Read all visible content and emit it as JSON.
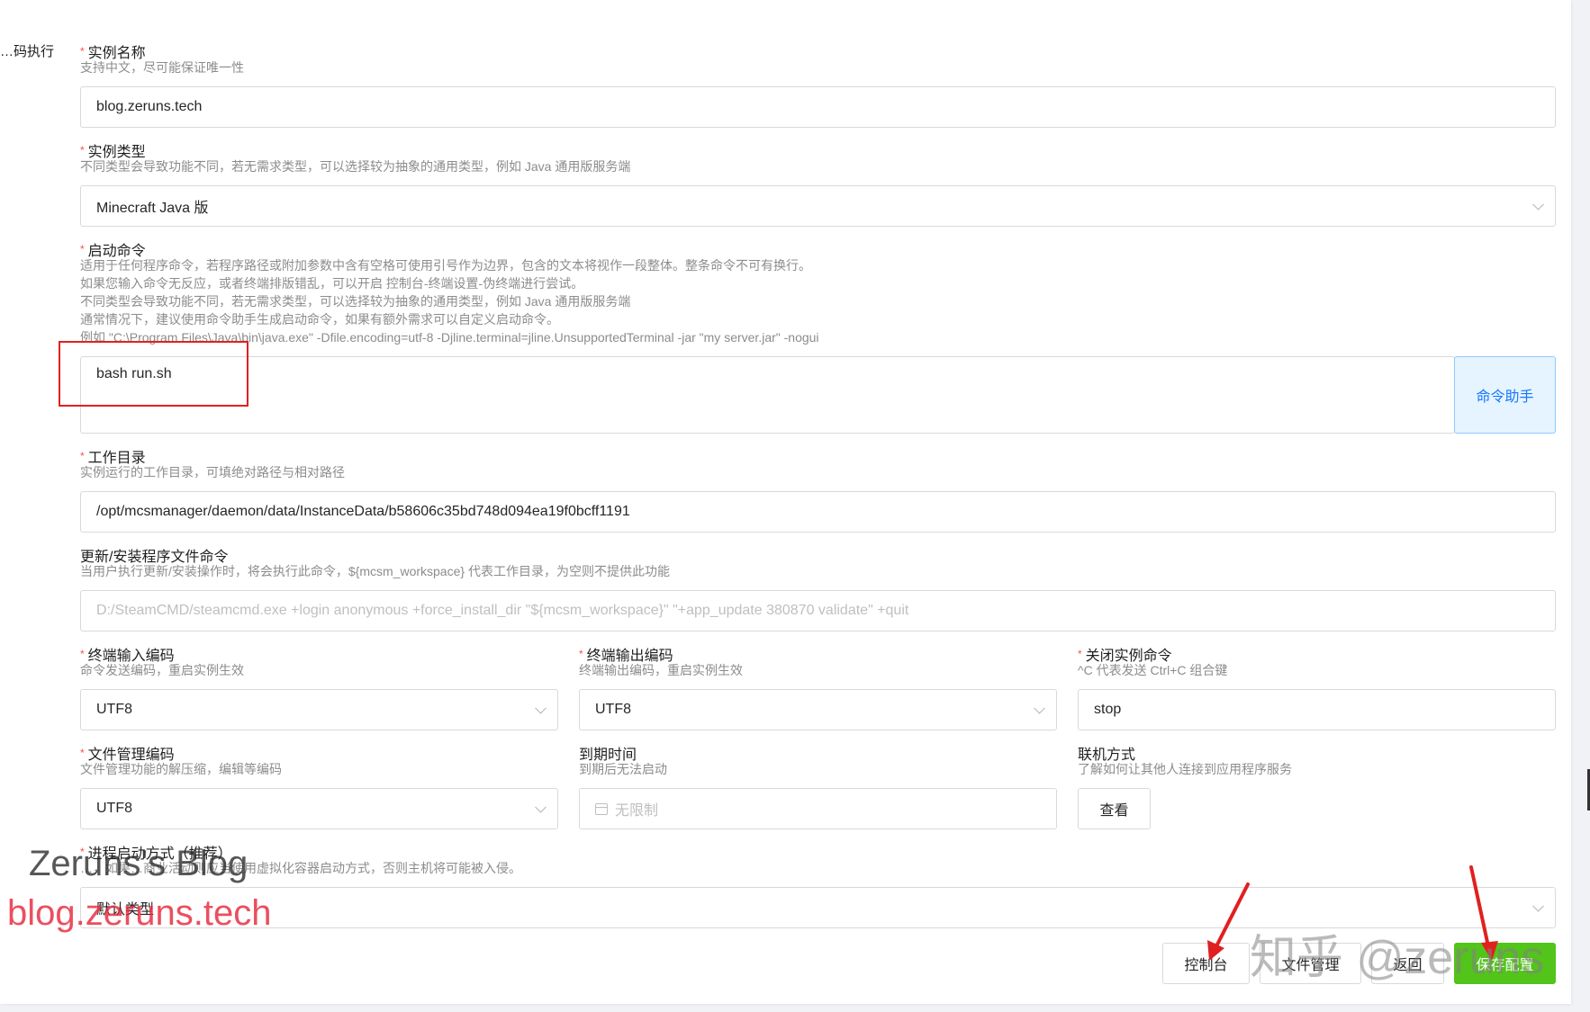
{
  "sidebar": {
    "partial_label": "…码执行"
  },
  "form": {
    "instance_name": {
      "label": "实例名称",
      "help": "支持中文，尽可能保证唯一性",
      "value": "blog.zeruns.tech"
    },
    "instance_type": {
      "label": "实例类型",
      "help": "不同类型会导致功能不同，若无需求类型，可以选择较为抽象的通用类型，例如 Java 通用版服务端",
      "value": "Minecraft Java 版"
    },
    "start_command": {
      "label": "启动命令",
      "help_lines": [
        "适用于任何程序命令，若程序路径或附加参数中含有空格可使用引号作为边界，包含的文本将视作一段整体。整条命令不可有换行。",
        "如果您输入命令无反应，或者终端排版错乱，可以开启 控制台-终端设置-伪终端进行尝试。",
        "不同类型会导致功能不同，若无需求类型，可以选择较为抽象的通用类型，例如 Java 通用版服务端",
        "通常情况下，建议使用命令助手生成启动命令，如果有额外需求可以自定义启动命令。",
        "例如 \"C:\\Program Files\\Java\\bin\\java.exe\" -Dfile.encoding=utf-8 -Djline.terminal=jline.UnsupportedTerminal -jar \"my server.jar\" -nogui"
      ],
      "value": "bash run.sh",
      "assist_button": "命令助手"
    },
    "work_dir": {
      "label": "工作目录",
      "help": "实例运行的工作目录，可填绝对路径与相对路径",
      "value": "/opt/mcsmanager/daemon/data/InstanceData/b58606c35bd748d094ea19f0bcff1191"
    },
    "update_command": {
      "label": "更新/安装程序文件命令",
      "help": "当用户执行更新/安装操作时，将会执行此命令，${mcsm_workspace} 代表工作目录，为空则不提供此功能",
      "placeholder": "D:/SteamCMD/steamcmd.exe +login anonymous +force_install_dir \"${mcsm_workspace}\" \"+app_update 380870 validate\" +quit"
    },
    "input_encoding": {
      "label": "终端输入编码",
      "help": "命令发送编码，重启实例生效",
      "value": "UTF8"
    },
    "output_encoding": {
      "label": "终端输出编码",
      "help": "终端输出编码，重启实例生效",
      "value": "UTF8"
    },
    "stop_command": {
      "label": "关闭实例命令",
      "help": "^C 代表发送 Ctrl+C 组合键",
      "value": "stop"
    },
    "file_encoding": {
      "label": "文件管理编码",
      "help": "文件管理功能的解压缩，编辑等编码",
      "value": "UTF8"
    },
    "expire_time": {
      "label": "到期时间",
      "help": "到期后无法启动",
      "placeholder": "无限制"
    },
    "network": {
      "label": "联机方式",
      "help": "了解如何让其他人连接到应用程序服务",
      "button": "查看"
    },
    "process_type": {
      "label": "进程启动方式（推荐）",
      "help": "…，如果…商业活动则应当使用虚拟化容器启动方式，否则主机将可能被入侵。",
      "value": "默认类型"
    }
  },
  "footer": {
    "console": "控制台",
    "file_manage": "文件管理",
    "back": "返回",
    "save": "保存配置"
  },
  "watermarks": {
    "blog_title": "Zeruns's Blog",
    "blog_url": "blog.zeruns.tech",
    "zhihu": "知乎 @zeruns"
  },
  "colors": {
    "required": "#ff4d4f",
    "primary": "#52c41a",
    "assist_bg": "#e6f4ff",
    "assist_text": "#1677ff",
    "annotation": "#e02020"
  }
}
